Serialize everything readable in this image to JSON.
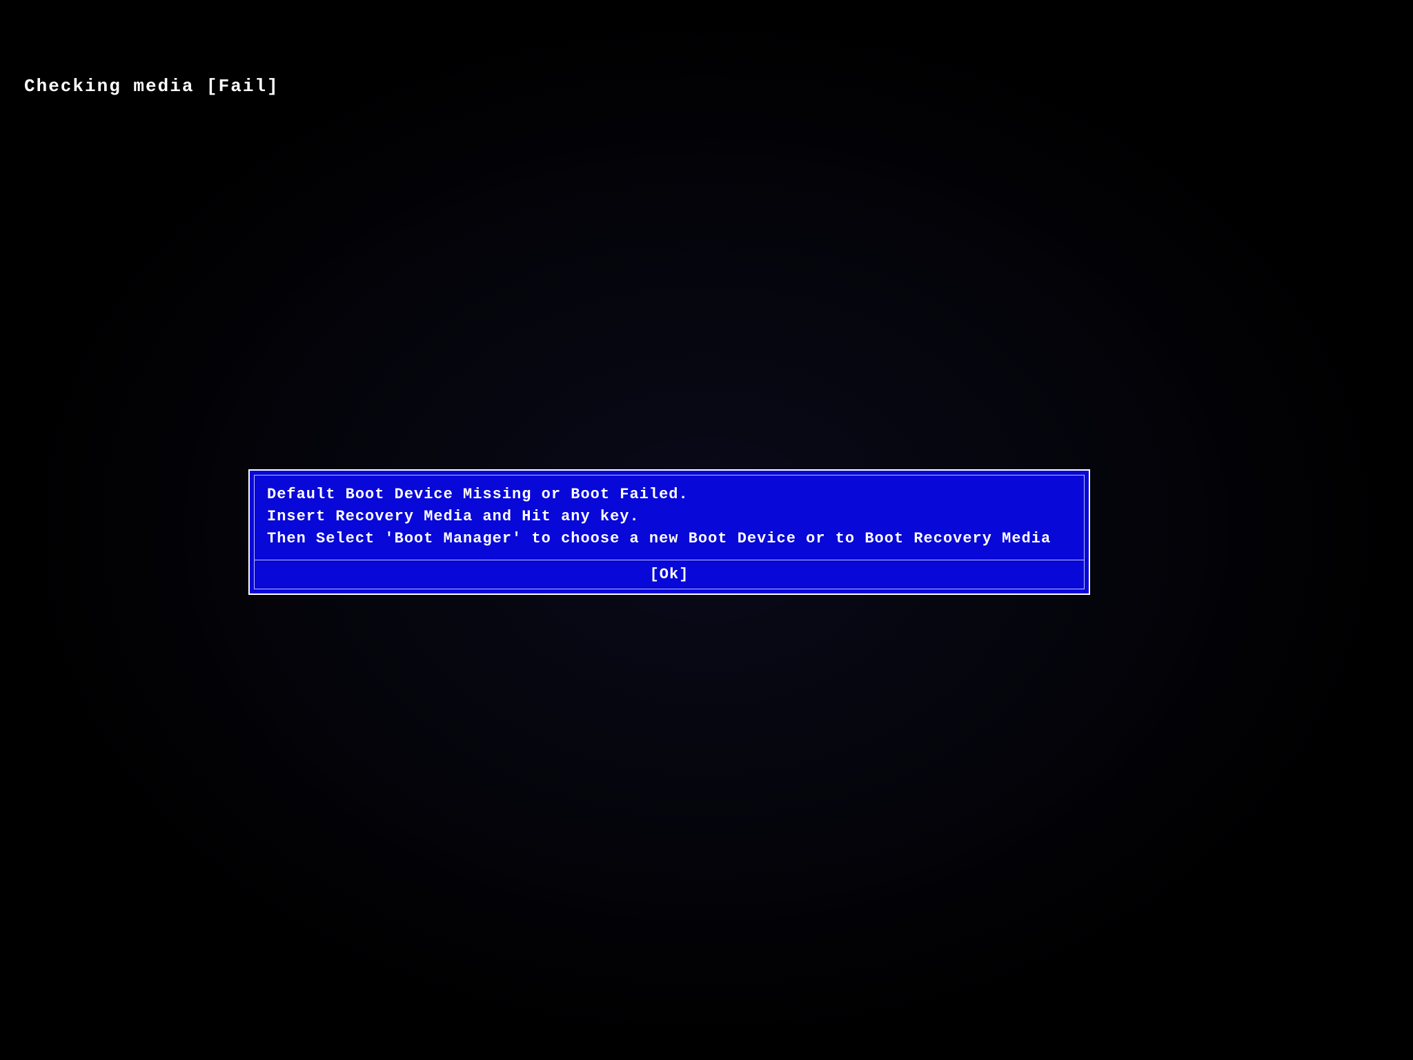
{
  "status": {
    "checking_media": "Checking media [Fail]"
  },
  "dialog": {
    "line1": "Default Boot Device Missing or Boot Failed.",
    "line2": "Insert Recovery Media and Hit any key.",
    "line3": "Then Select 'Boot Manager' to choose a new Boot Device or to Boot Recovery Media",
    "ok_label": "[Ok]"
  }
}
